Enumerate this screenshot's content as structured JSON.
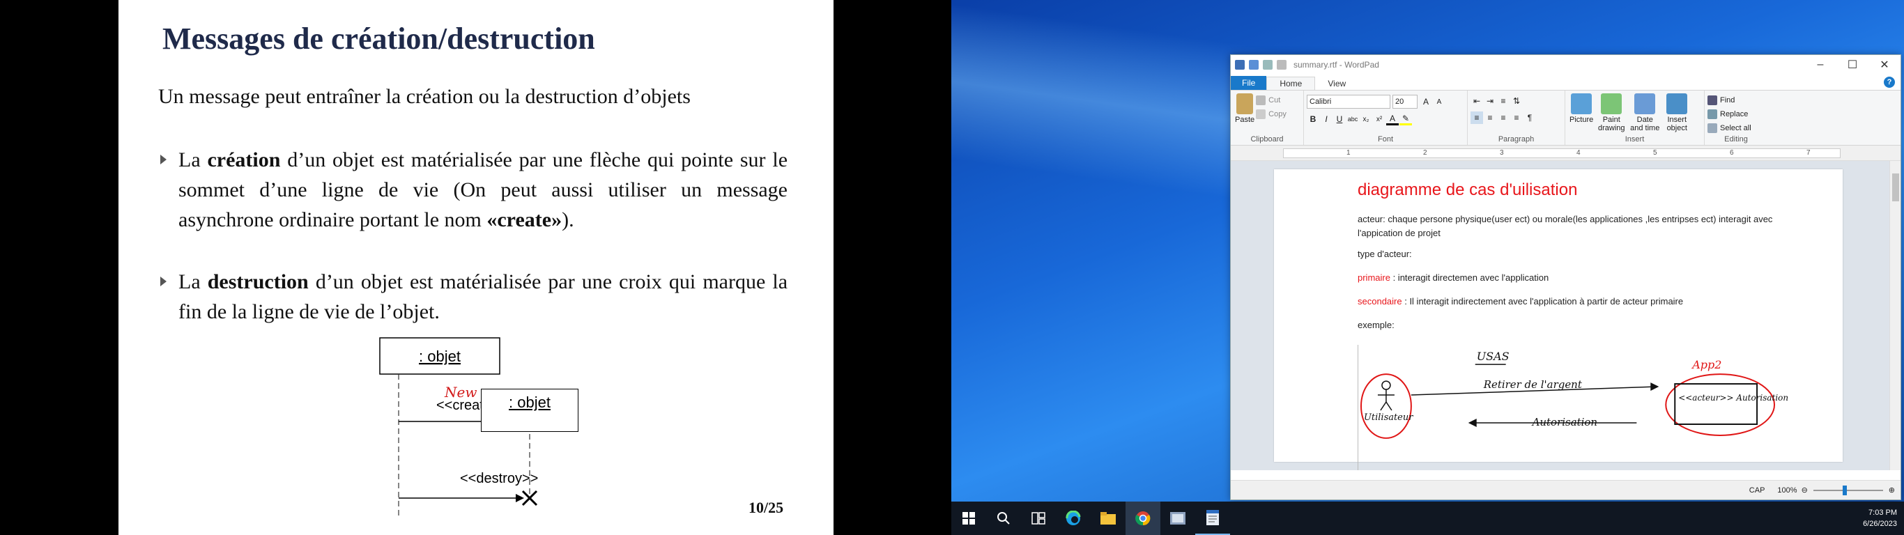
{
  "slide": {
    "title": "Messages de création/destruction",
    "intro": "Un message peut entraîner la création ou la destruction d’objets",
    "bullet1_pre": "La ",
    "bullet1_bold": "création",
    "bullet1_mid": " d’un objet est matérialisée par une flèche qui pointe sur le sommet d’une ligne de vie (On peut aussi utiliser un message asynchrone ordinaire portant le nom ",
    "bullet1_bold2": "«create»",
    "bullet1_end": ").",
    "bullet2_pre": "La ",
    "bullet2_bold": "destruction",
    "bullet2_end": " d’un objet est matérialisée par une croix qui marque la fin de la ligne de vie de l’objet.",
    "diagram": {
      "obj1": ": objet",
      "obj2": ": objet",
      "create_msg": "<<create>>",
      "destroy_msg": "<<destroy>>",
      "annotation": "New"
    },
    "page_number": "10/25"
  },
  "wordpad": {
    "title": "summary.rtf - WordPad",
    "tabs": [
      "File",
      "Home",
      "View"
    ],
    "clipboard": {
      "paste": "Paste",
      "cut": "Cut",
      "copy": "Copy",
      "group": "Clipboard"
    },
    "font": {
      "family": "Calibri",
      "size": "20",
      "group": "Font"
    },
    "paragraph_group": "Paragraph",
    "insert": {
      "picture": "Picture",
      "paint": "Paint drawing",
      "datetime": "Date and time",
      "object": "Insert object",
      "group": "Insert"
    },
    "editing": {
      "find": "Find",
      "replace": "Replace",
      "select_all": "Select all",
      "group": "Editing"
    },
    "ruler_marks": [
      "1",
      "2",
      "3",
      "4",
      "5",
      "6",
      "7"
    ],
    "document": {
      "heading": "diagramme de cas d'uilisation",
      "p1": "acteur: chaque persone physique(user ect) ou morale(les applicationes ,les entripses ect) interagit avec l'appication de projet",
      "p2": "type d'acteur:",
      "primary_label": "primaire",
      "primary_text": " : interagit directemen avec l'application",
      "secondary_label": "secondaire",
      "secondary_text": " : Il interagit indirectement avec l'application à partir de  acteur primaire",
      "p_example": "exemple:"
    },
    "handwriting": {
      "top": "USAS",
      "app2": "App2",
      "actor": "Utilisateur",
      "arrow1": "Retirer de l'argent",
      "arrow2": "Autorisation",
      "box": "<<acteur>> Autorisation"
    },
    "status": {
      "caps": "CAP",
      "zoom": "100%"
    }
  },
  "taskbar": {
    "time": "7:03 PM",
    "date": "6/26/2023"
  }
}
